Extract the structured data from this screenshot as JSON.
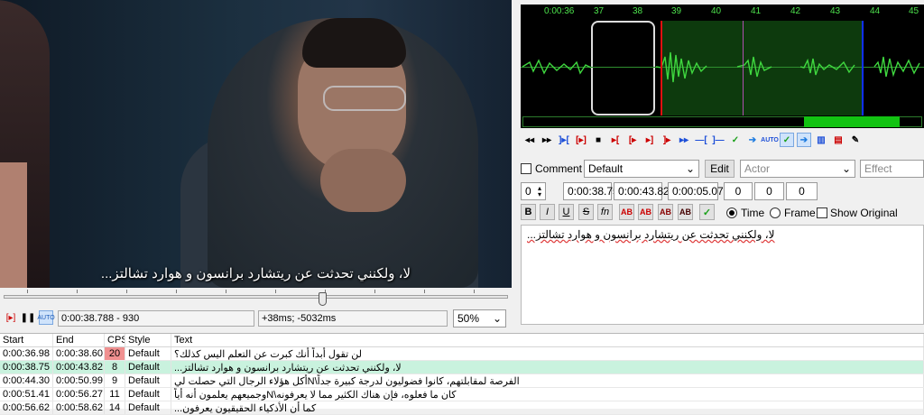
{
  "video": {
    "subtitle": "لا، ولكنني تحدثت عن ريتشارد برانسون و هوارد تشالتز..."
  },
  "video_controls": {
    "timecode": "0:00:38.788 - 930",
    "offset": "+38ms; -5032ms",
    "zoom": "50%",
    "seek_position": 0.625
  },
  "waveform": {
    "ruler_labels": [
      "0:00:36",
      "37",
      "38",
      "39",
      "40",
      "41",
      "42",
      "43",
      "44",
      "45"
    ]
  },
  "edit": {
    "comment_label": "Comment",
    "style_value": "Default",
    "edit_button": "Edit",
    "actor_placeholder": "Actor",
    "effect_placeholder": "Effect",
    "layer": "0",
    "start_time": "0:00:38.75",
    "end_time": "0:00:43.82",
    "duration": "0:00:05.07",
    "margin_left": "0",
    "margin_right": "0",
    "margin_vert": "0",
    "bold": "B",
    "italic": "I",
    "underline": "U",
    "strike": "S",
    "fn": "fn",
    "ab": "AB",
    "time_label": "Time",
    "frame_label": "Frame",
    "show_original_label": "Show Original",
    "text": "لا، ولكنني تحدثت عن ريتشارد برانسون و هوارد تشالتز..."
  },
  "grid": {
    "headers": [
      "Start",
      "End",
      "CPS",
      "Style",
      "Text"
    ],
    "rows": [
      {
        "start": "0:00:36.98",
        "end": "0:00:38.60",
        "cps": "20",
        "style": "Default",
        "text": "لن تقول أبداً أنك كبرت عن التعلم اليس كذلك؟",
        "cps_warn": true
      },
      {
        "start": "0:00:38.75",
        "end": "0:00:43.82",
        "cps": "8",
        "style": "Default",
        "text": "لا، ولكنني تحدثت عن ريتشارد برانسون و هوارد تشالتز...",
        "selected": true
      },
      {
        "start": "0:00:44.30",
        "end": "0:00:50.99",
        "cps": "9",
        "style": "Default",
        "text": "الفرصة لمقابلتهم، كانوا فضوليون لدرجة كبيرة جداً\\Nأكل هؤلاء الرجال التي حصلت لي"
      },
      {
        "start": "0:00:51.41",
        "end": "0:00:56.27",
        "cps": "11",
        "style": "Default",
        "text": "كان ما فعلوه، فإن هناك الكثير مما لا يعرفونه\\Nوجميعهم يعلمون أنه أياً"
      },
      {
        "start": "0:00:56.62",
        "end": "0:00:58.62",
        "cps": "14",
        "style": "Default",
        "text": "كما أن الأذكياء الحقيقيون يعرفون..."
      }
    ]
  }
}
